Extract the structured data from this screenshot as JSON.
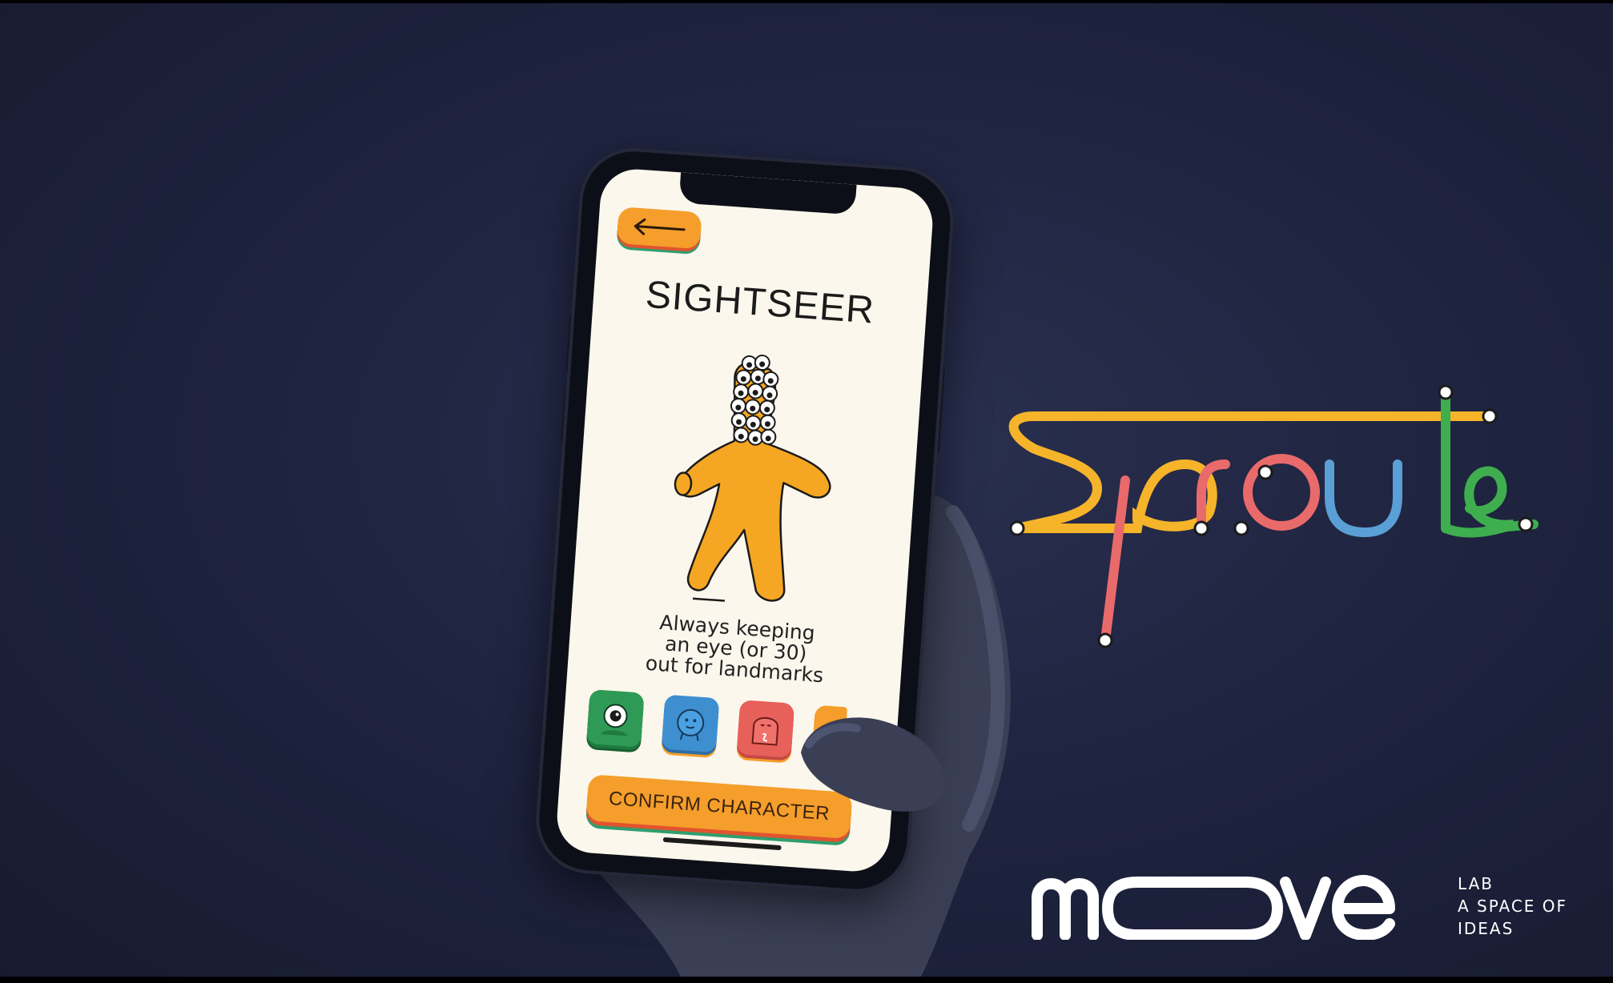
{
  "screen": {
    "title": "SIGHTSEER",
    "description_lines": [
      "Always keeping",
      "an eye (or 30)",
      "out for landmarks"
    ],
    "confirm_label": "CONFIRM CHARACTER",
    "back_icon": "arrow-left-icon",
    "characters": [
      {
        "name": "green-cyclops-icon",
        "color": "#2e9a55"
      },
      {
        "name": "blue-blob-icon",
        "color": "#3e8fd0"
      },
      {
        "name": "red-ghost-icon",
        "color": "#e8605a"
      },
      {
        "name": "orange-partial-icon",
        "color": "#f59e2b"
      }
    ]
  },
  "branding": {
    "app_logo": "Sproute",
    "logo_colors": [
      "#f5b42a",
      "#e96a6a",
      "#5a9fd6",
      "#3fae4e"
    ],
    "company": "moove",
    "tag_lines": [
      "LAB",
      "A SPACE OF",
      "IDEAS"
    ]
  },
  "colors": {
    "accent_orange": "#f59e2b",
    "screen_bg": "#fbf7ec",
    "background": "#1f2440"
  }
}
